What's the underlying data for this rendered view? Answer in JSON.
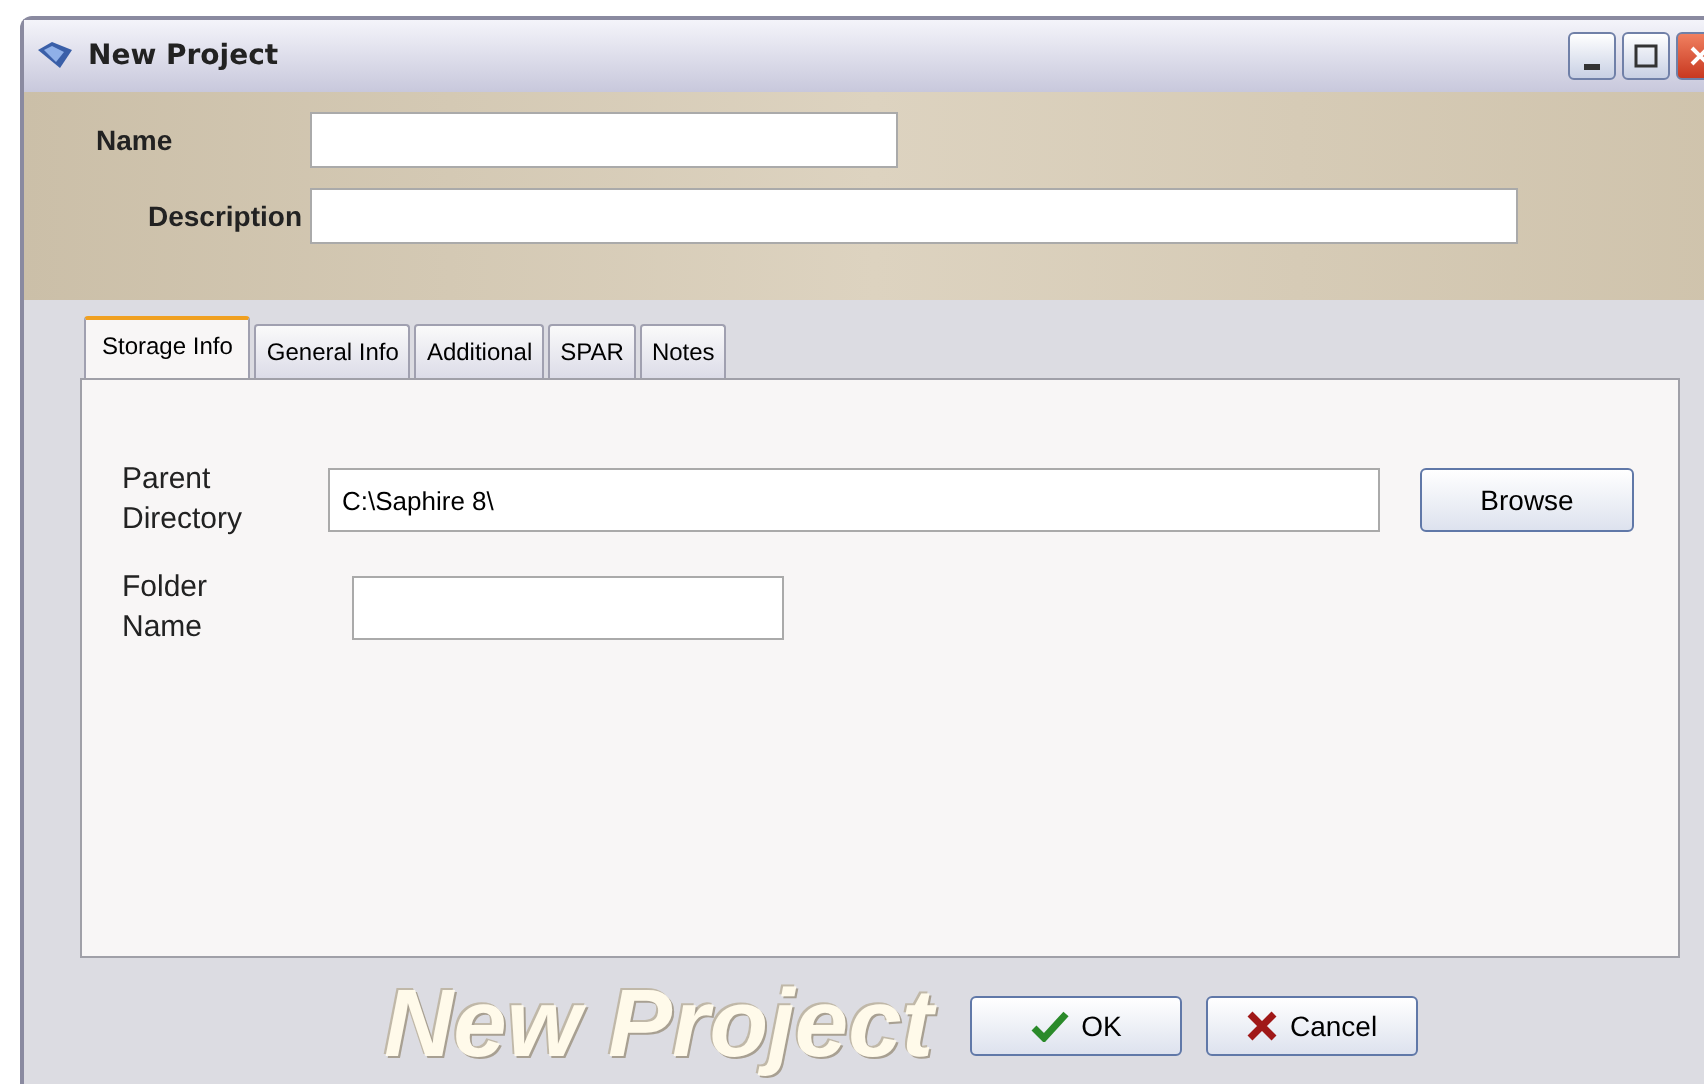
{
  "window": {
    "title": "New Project"
  },
  "fields": [
    {
      "label": "Name",
      "kind": "short"
    },
    {
      "label": "Description",
      "kind": "long"
    }
  ],
  "tabs": [
    {
      "label": "Storage Info",
      "selected": true
    },
    {
      "label": "General Info",
      "selected": false
    },
    {
      "label": "Additional",
      "selected": false
    },
    {
      "label": "SPAR",
      "selected": false
    },
    {
      "label": "Notes",
      "selected": false
    }
  ],
  "storage": [
    {
      "label": "Parent Directory",
      "value": "C:\\Saphire 8\\",
      "kind": "long"
    },
    {
      "label": "Folder Name",
      "kind": "short"
    }
  ],
  "browse_button": "Browse",
  "banner_text": "New Project",
  "buttons": [
    {
      "label": "OK",
      "kind": "ok"
    },
    {
      "label": "Cancel",
      "kind": "cancel"
    }
  ]
}
